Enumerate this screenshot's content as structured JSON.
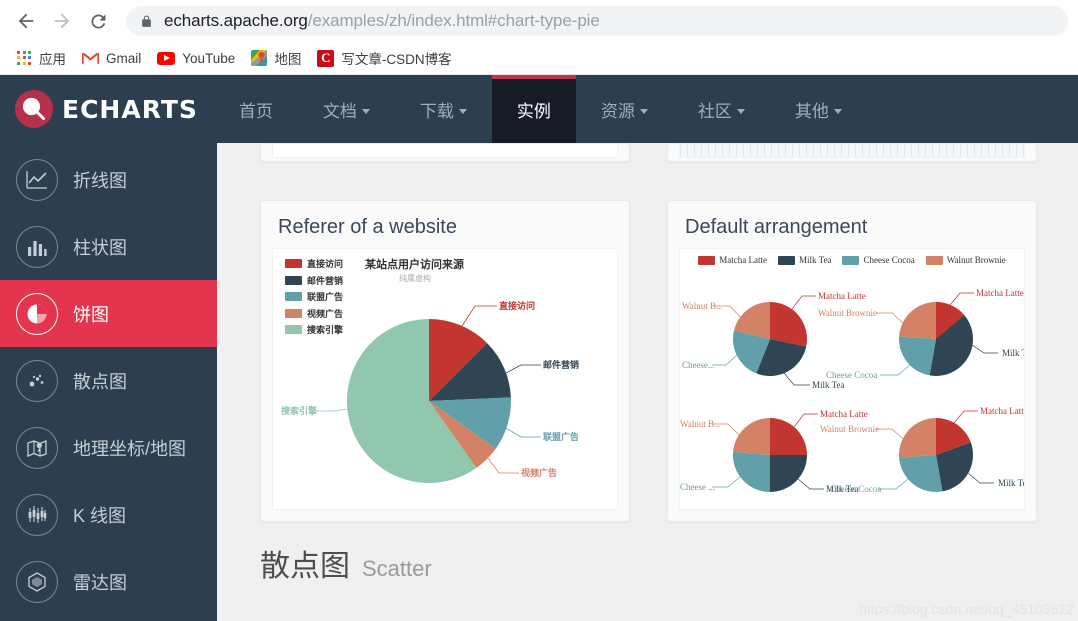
{
  "browser": {
    "back_icon": "back-arrow-icon",
    "forward_icon": "forward-arrow-icon",
    "reload_icon": "reload-icon",
    "lock_icon": "lock-icon",
    "url_host": "echarts.apache.org",
    "url_path": "/examples/zh/index.html#chart-type-pie",
    "url_full": "echarts.apache.org/examples/zh/index.html#chart-type-pie",
    "bookmarks": [
      {
        "label": "应用",
        "icon": "apps-grid-icon"
      },
      {
        "label": "Gmail",
        "icon": "gmail-icon"
      },
      {
        "label": "YouTube",
        "icon": "youtube-icon"
      },
      {
        "label": "地图",
        "icon": "google-maps-icon"
      },
      {
        "label": "写文章-CSDN博客",
        "icon": "csdn-icon"
      }
    ]
  },
  "site": {
    "logo_text": "ECHARTS",
    "logo_icon": "echarts-logo-icon",
    "nav": [
      {
        "label": "首页",
        "caret": false,
        "active": false
      },
      {
        "label": "文档",
        "caret": true,
        "active": false
      },
      {
        "label": "下载",
        "caret": true,
        "active": false
      },
      {
        "label": "实例",
        "caret": false,
        "active": true
      },
      {
        "label": "资源",
        "caret": true,
        "active": false
      },
      {
        "label": "社区",
        "caret": true,
        "active": false
      },
      {
        "label": "其他",
        "caret": true,
        "active": false
      }
    ],
    "sidebar": [
      {
        "label": "折线图",
        "icon": "line-chart-icon",
        "active": false
      },
      {
        "label": "柱状图",
        "icon": "bar-chart-icon",
        "active": false
      },
      {
        "label": "饼图",
        "icon": "pie-chart-icon",
        "active": true
      },
      {
        "label": "散点图",
        "icon": "scatter-chart-icon",
        "active": false
      },
      {
        "label": "地理坐标/地图",
        "icon": "map-chart-icon",
        "active": false
      },
      {
        "label": "K 线图",
        "icon": "candlestick-chart-icon",
        "active": false
      },
      {
        "label": "雷达图",
        "icon": "radar-chart-icon",
        "active": false
      }
    ],
    "section": {
      "cn": "散点图",
      "en": "Scatter"
    },
    "watermark": "https://blog.csdn.net/qq_45103612",
    "colors": {
      "nav_bg": "#2c3e50",
      "nav_active_bg": "#161b26",
      "accent": "#c0334d",
      "sidebar_active": "#e5344e",
      "page_bg": "#f0f0f0",
      "card_bg": "#fafafa"
    }
  },
  "cards": [
    {
      "title": "Referer of a website"
    },
    {
      "title": "Default arrangement"
    }
  ],
  "chart_data": [
    {
      "type": "pie",
      "card_title": "Referer of a website",
      "title": "某站点用户访问来源",
      "subtitle": "纯属虚构",
      "legend_position": "top-left-vertical",
      "legend": [
        "直接访问",
        "邮件营销",
        "联盟广告",
        "视频广告",
        "搜索引擎"
      ],
      "labels": [
        "直接访问",
        "邮件营销",
        "联盟广告",
        "视频广告",
        "搜索引擎"
      ],
      "values": [
        335,
        310,
        234,
        135,
        1548
      ],
      "colors": [
        "#c23531",
        "#2f4554",
        "#61a0a8",
        "#d48265",
        "#91c7ae"
      ],
      "grid": false
    },
    {
      "type": "pie",
      "card_title": "Default arrangement",
      "title": "",
      "legend_position": "top-center-horizontal",
      "legend": [
        "Matcha Latte",
        "Milk Tea",
        "Cheese Cocoa",
        "Walnut Brownie"
      ],
      "colors": [
        "#c23531",
        "#2f4554",
        "#61a0a8",
        "#d48265"
      ],
      "grid": false,
      "pies": [
        {
          "name": "pie-top-left",
          "labels": [
            "Matcha Latte",
            "Milk Tea",
            "Cheese Cocoa",
            "Walnut Brownie"
          ],
          "values": [
            78,
            145,
            45,
            92
          ]
        },
        {
          "name": "pie-top-right",
          "labels": [
            "Matcha Latte",
            "Milk Tea",
            "Cheese Cocoa",
            "Walnut Brownie"
          ],
          "values": [
            50,
            130,
            95,
            85
          ]
        },
        {
          "name": "pie-bottom-left",
          "labels": [
            "Matcha Latte",
            "Milk Tea",
            "Cheese Cocoa",
            "Walnut Brownie"
          ],
          "values": [
            90,
            90,
            95,
            85
          ]
        },
        {
          "name": "pie-bottom-right",
          "labels": [
            "Matcha Latte",
            "Milk Tea",
            "Cheese Cocoa",
            "Walnut Brownie"
          ],
          "values": [
            70,
            100,
            105,
            85
          ]
        }
      ],
      "pie_labels_truncated": [
        "Walnut B...",
        "Cheese...",
        "Cheese ...",
        "Cheese Cocoa",
        "Walnut Brownie"
      ]
    }
  ]
}
